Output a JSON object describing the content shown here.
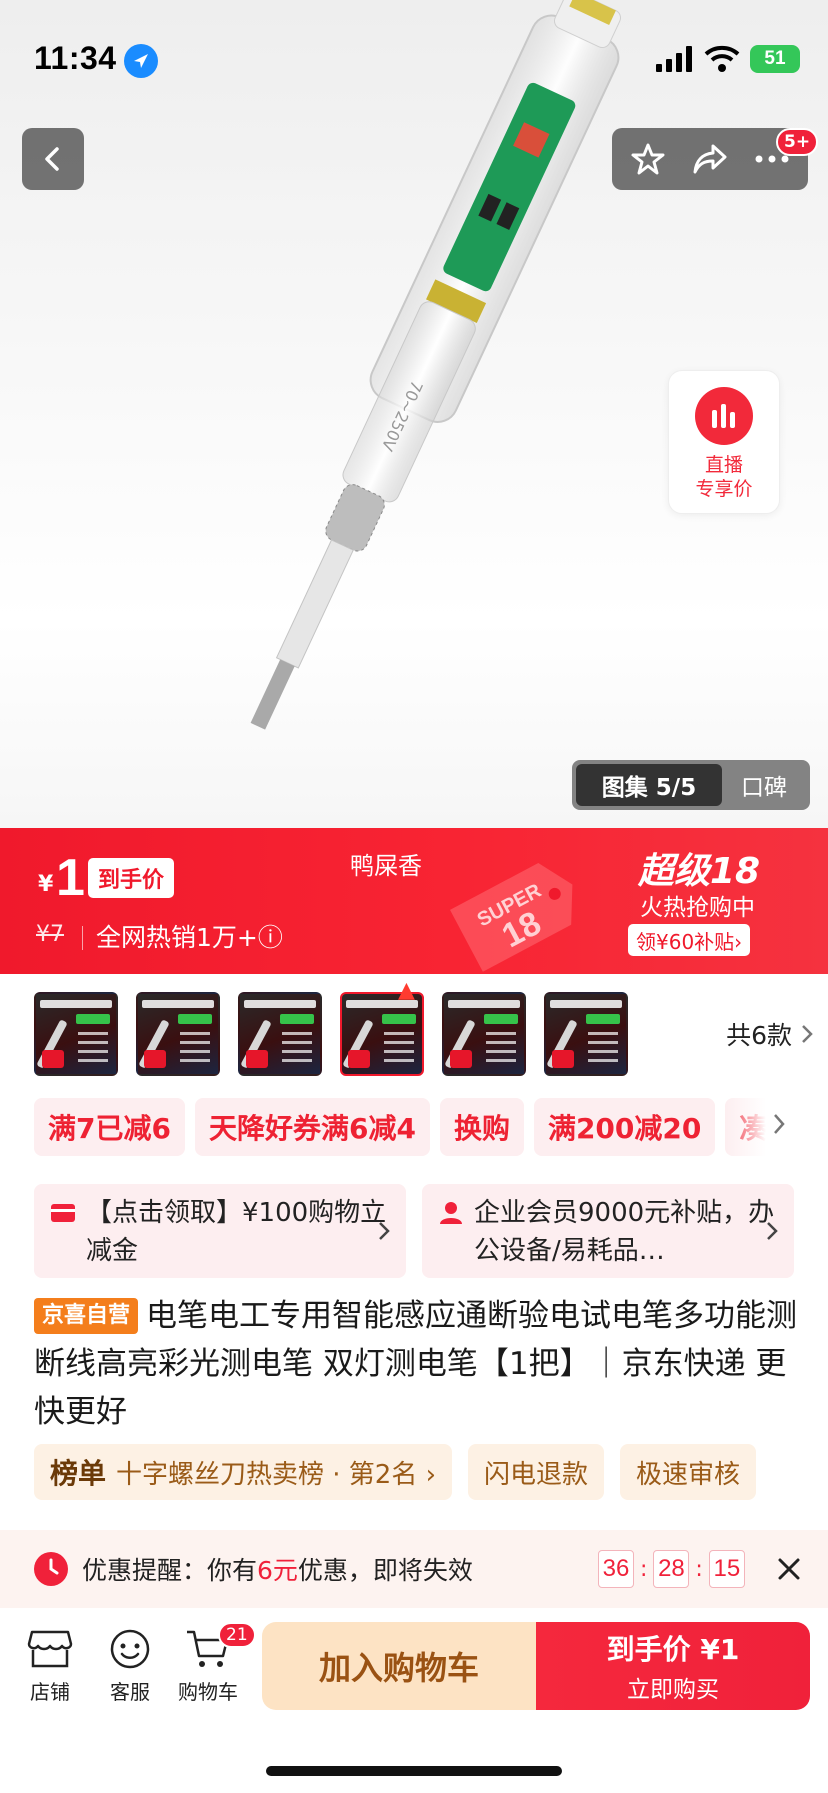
{
  "status_bar": {
    "time": "11:34",
    "battery": "51"
  },
  "header": {
    "cart_badge": "5+"
  },
  "live": {
    "line1": "直播",
    "line2": "专享价"
  },
  "gallery": {
    "active_label": "图集 5/5",
    "other_label": "口碑"
  },
  "price_banner": {
    "currency": "¥",
    "price": "1",
    "price_tag": "到手价",
    "original_price": "¥7",
    "sales": "全网热销1万+ⓘ",
    "variant_name": "鸭屎香",
    "super_tag_line1": "SUPER",
    "super_tag_line2": "18",
    "super_title": "超级18",
    "hot_text": "火热抢购中",
    "coupon": "领¥60补贴›"
  },
  "variants": {
    "count_label": "共6款",
    "selected_index": 3,
    "thumb_count": 6
  },
  "promo_chips": [
    "满7已减6",
    "天降好券满6减4",
    "换购",
    "满200减20",
    "凑单"
  ],
  "benefits": [
    {
      "text": "【点击领取】¥100购物立减金",
      "icon": "card-icon"
    },
    {
      "text": "企业会员9000元补贴，办公设备/易耗品…",
      "icon": "person-icon"
    }
  ],
  "product": {
    "self_tag": "京喜自营",
    "title": "电笔电工专用智能感应通断验电试电笔多功能测断线高亮彩光测电笔 双灯测电笔【1把】｜京东快递 更快更好"
  },
  "rank": {
    "label": "榜单",
    "text": "十字螺丝刀热卖榜 · 第2名 ›",
    "extra": [
      "闪电退款",
      "极速审核"
    ]
  },
  "reminder": {
    "prefix": "优惠提醒：你有",
    "amount": "6元",
    "suffix": "优惠，即将失效",
    "hours": "36",
    "minutes": "28",
    "seconds": "15"
  },
  "bottom_nav": {
    "store": "店铺",
    "service": "客服",
    "cart": "购物车",
    "cart_count": "21",
    "add_to_cart": "加入购物车",
    "buy_line1": "到手价 ¥1",
    "buy_line2": "立即购买"
  },
  "colors": {
    "accent": "#f0213a",
    "self_tag": "#f47e1c",
    "add_cart_bg": "#fde3c4"
  }
}
